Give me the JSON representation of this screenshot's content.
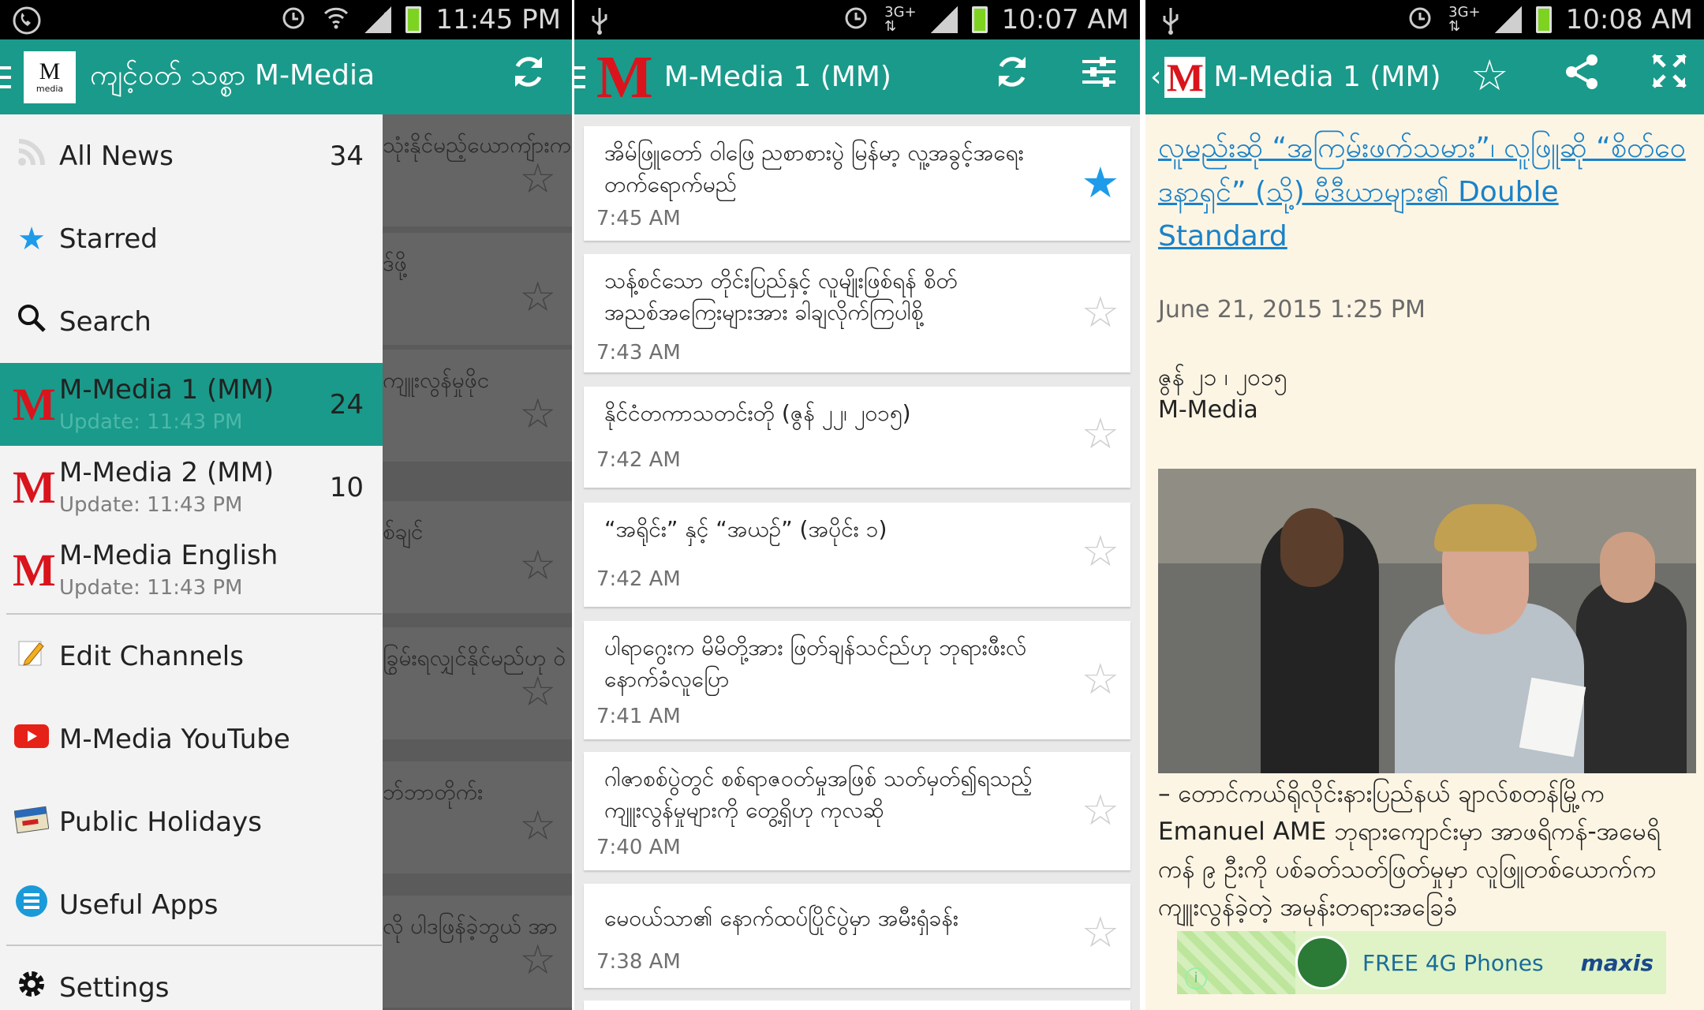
{
  "screen1": {
    "status": {
      "time": "11:45 PM"
    },
    "appbar": {
      "title": "ကျင့်ဝတ် သစ္စာ M-Media",
      "logo_text": "M",
      "logo_sub": "media"
    },
    "drawer": {
      "all_news": {
        "label": "All News",
        "count": "34"
      },
      "starred": {
        "label": "Starred"
      },
      "search": {
        "label": "Search"
      },
      "channels": [
        {
          "name": "M-Media 1 (MM)",
          "update": "Update: 11:43 PM",
          "count": "24"
        },
        {
          "name": "M-Media 2 (MM)",
          "update": "Update: 11:43 PM",
          "count": "10"
        },
        {
          "name": "M-Media English",
          "update": "Update: 11:43 PM",
          "count": ""
        }
      ],
      "edit_channels": "Edit Channels",
      "youtube": "M-Media YouTube",
      "holidays": "Public Holidays",
      "useful_apps": "Useful Apps",
      "settings": "Settings"
    },
    "behind": [
      "သုံးနိုင်မည့်ယောကျ်ားက",
      "ဒ်ဖို့",
      "ကျူးလွန်မှုဖိုင",
      "စ်ချင်",
      "ခြွမ်းရလျှင်နိုင်မည်ဟု ဝဲ",
      "ဘ်ဘာတိုက်း",
      "လို ပါဒဖြန်ခဲ့ဘွယ် အာ"
    ]
  },
  "screen2": {
    "status": {
      "time": "10:07 AM"
    },
    "appbar": {
      "title": "M-Media 1 (MM)"
    },
    "items": [
      {
        "headline": "အိမ်ဖြူတော် ဝါဖြေ ညစာစားပွဲ မြန်မာ့ လူ့အခွင့်အရေး တက်ရောက်မည်",
        "time": "7:45 AM",
        "starred": true
      },
      {
        "headline": "သန့်စင်သော တိုင်းပြည်နှင့် လူမျိုးဖြစ်ရန် စိတ်အညစ်အကြေးများအား ခါချလိုက်ကြပါစို့",
        "time": "7:43 AM",
        "starred": false
      },
      {
        "headline": "နိုင်ငံတကာသတင်းတို (ဇွန် ၂၂၊ ၂၀၁၅)",
        "time": "7:42 AM",
        "starred": false
      },
      {
        "headline": "“အရိုင်း” နှင့် “အယဉ်” (အပိုင်း ၁)",
        "time": "7:42 AM",
        "starred": false
      },
      {
        "headline": "ပါရာဂွေးက မိမိတို့အား ဖြတ်ချန်သင်ည်ဟု ဘုရားဖီးလ်နောက်ခံလူပြော",
        "time": "7:41 AM",
        "starred": false
      },
      {
        "headline": "ဂါဇာစစ်ပွဲတွင် စစ်ရာဇဝတ်မှုအဖြစ် သတ်မှတ်၍ရသည့် ကျူးလွန်မှုများကို တွေ့ရှိဟု ကုလဆို",
        "time": "7:40 AM",
        "starred": false
      },
      {
        "headline": "မေဝယ်သာ၏ နောက်ထပ်ပြိုင်ပွဲမှာ အမီးရှံခန်း",
        "time": "7:38 AM",
        "starred": false
      }
    ]
  },
  "screen3": {
    "status": {
      "time": "10:08 AM"
    },
    "appbar": {
      "title": "M-Media 1 (MM)"
    },
    "article": {
      "title": "လူမည်းဆို “အကြမ်းဖက်သမား”၊ လူဖြူဆို “စိတ်ဝေဒနာရှင်” (သို့) မီဒီယာများ၏ Double Standard",
      "date": "June 21, 2015 1:25 PM",
      "dateline": "ဇွန် ၂၁ ၊ ၂၀၁၅",
      "source": "M-Media",
      "body": "– တောင်ကယ်ရိုလိုင်းနားပြည်နယ် ချာလ်စတန်မြို့က Emanuel AME ဘုရားကျောင်းမှာ အာဖရိကန်-အမေရိကန် ၉ ဦးကို ပစ်ခတ်သတ်ဖြတ်မှုမှာ လူဖြူတစ်ယောက်က ကျူးလွန်ခဲ့တဲ့ အမုန်းတရားအခြေခံ"
    },
    "ad": {
      "text": "FREE 4G Phones",
      "brand": "maxis",
      "info": "i"
    }
  }
}
